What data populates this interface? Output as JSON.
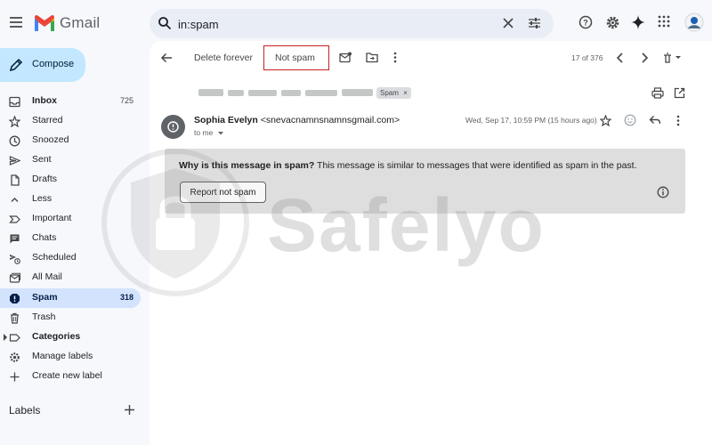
{
  "app": {
    "name": "Gmail"
  },
  "search": {
    "query": "in:spam"
  },
  "compose": {
    "label": "Compose"
  },
  "sidebar": {
    "items": [
      {
        "label": "Inbox",
        "count": "725"
      },
      {
        "label": "Starred"
      },
      {
        "label": "Snoozed"
      },
      {
        "label": "Sent"
      },
      {
        "label": "Drafts"
      },
      {
        "label": "Less"
      },
      {
        "label": "Important"
      },
      {
        "label": "Chats"
      },
      {
        "label": "Scheduled"
      },
      {
        "label": "All Mail"
      },
      {
        "label": "Spam",
        "count": "318"
      },
      {
        "label": "Trash"
      },
      {
        "label": "Categories"
      },
      {
        "label": "Manage labels"
      },
      {
        "label": "Create new label"
      }
    ],
    "labels_heading": "Labels"
  },
  "toolbar": {
    "delete_forever": "Delete forever",
    "not_spam": "Not spam",
    "pager": "17 of 376"
  },
  "message": {
    "chip": "Spam",
    "sender_name": "Sophia Evelyn",
    "sender_email": "<snevacnamnsnamnsgmail.com>",
    "to": "to me",
    "date": "Wed, Sep 17, 10:59 PM (15 hours ago)"
  },
  "banner": {
    "question": "Why is this message in spam?",
    "explanation": " This message is similar to messages that were identified as spam in the past.",
    "button": "Report not spam"
  },
  "watermark": {
    "text": "Safelyo"
  },
  "colors": {
    "accent": "#0b57d0",
    "compose_bg": "#c2e7ff",
    "active_bg": "#d3e3fd",
    "highlight_box": "#c5221f"
  }
}
